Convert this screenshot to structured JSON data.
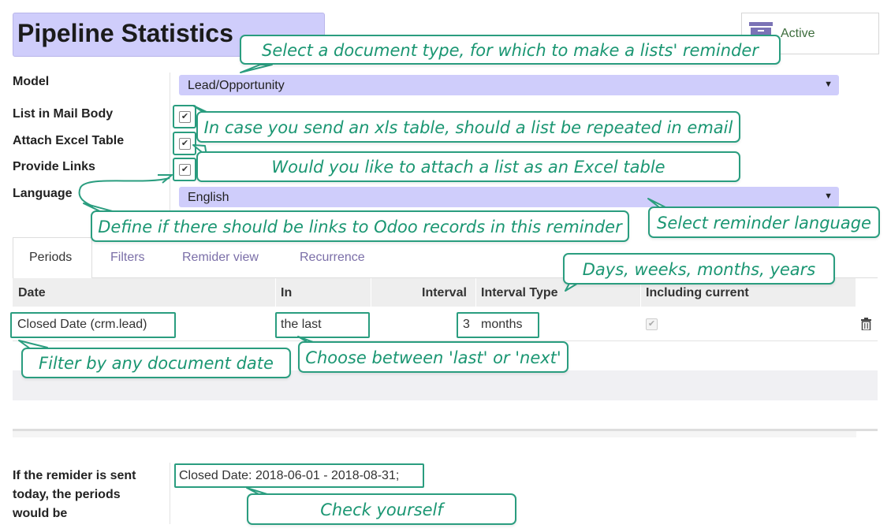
{
  "form": {
    "title": "Pipeline Statistics",
    "active_label": "Active"
  },
  "fields": {
    "model_label": "Model",
    "model_value": "Lead/Opportunity",
    "list_in_mail_label": "List in Mail Body",
    "attach_excel_label": "Attach Excel Table",
    "provide_links_label": "Provide Links",
    "language_label": "Language",
    "language_value": "English",
    "checkbox_mark": "✔"
  },
  "tabs": [
    {
      "label": "Periods"
    },
    {
      "label": "Filters"
    },
    {
      "label": "Remider view"
    },
    {
      "label": "Recurrence"
    }
  ],
  "table": {
    "headers": [
      "Date",
      "In",
      "Interval",
      "Interval Type",
      "Including current"
    ],
    "rows": [
      {
        "date": "Closed Date (crm.lead)",
        "in": "the last",
        "interval": "3",
        "interval_type": "months",
        "including_current": true
      }
    ]
  },
  "period_preview": {
    "label": "If the remider is sent today, the periods would be",
    "label_line1": "If the remider is sent",
    "label_line2": "today, the periods",
    "label_line3": "would be",
    "value": "Closed Date: 2018-06-01 - 2018-08-31;"
  },
  "callouts": {
    "document_type": "Select a document type, for which to make a lists' reminder",
    "xls_list": "In case you send an xls table, should a list be repeated in email",
    "excel_attach": "Would you like to attach a list as an Excel table",
    "links": "Define if there should be links to Odoo records in this reminder",
    "language": "Select reminder language",
    "interval_type": "Days, weeks, months, years",
    "document_date": "Filter by any document date",
    "last_next": "Choose between 'last' or 'next'",
    "check": "Check yourself"
  },
  "colors": {
    "accent_purple_fill": "#cfcdfb",
    "callout_green": "#2a9d7f",
    "tab_link": "#7b6fa8"
  },
  "icons": [
    "archive-icon",
    "dropdown-arrow-icon",
    "trash-icon",
    "checkbox-icon"
  ]
}
